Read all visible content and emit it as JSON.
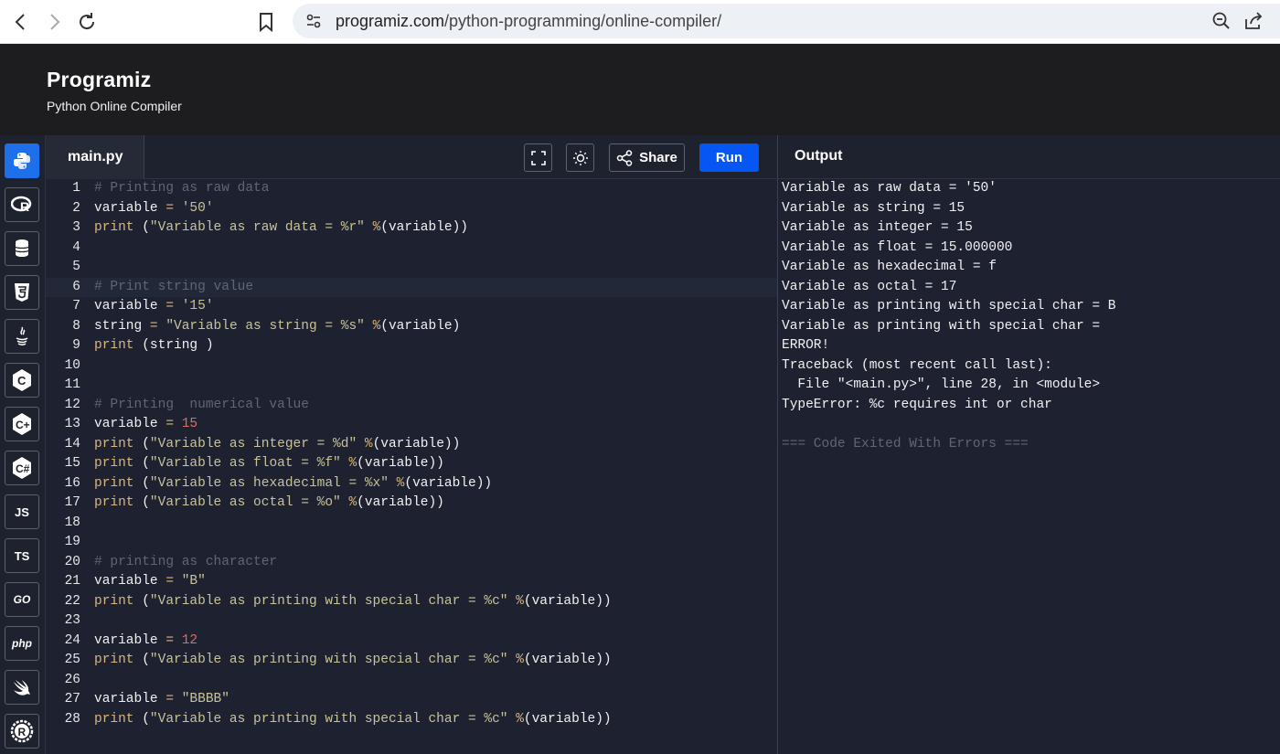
{
  "browser": {
    "url_domain": "programiz.com",
    "url_path": "/python-programming/online-compiler/"
  },
  "header": {
    "logo": "Programiz",
    "subtitle": "Python Online Compiler"
  },
  "languages": [
    {
      "name": "python",
      "label": "",
      "active": true
    },
    {
      "name": "r",
      "label": "R"
    },
    {
      "name": "sql",
      "label": ""
    },
    {
      "name": "html",
      "label": "5"
    },
    {
      "name": "java",
      "label": ""
    },
    {
      "name": "c",
      "label": "C"
    },
    {
      "name": "cpp",
      "label": "C+"
    },
    {
      "name": "csharp",
      "label": "C#"
    },
    {
      "name": "javascript",
      "label": "JS"
    },
    {
      "name": "typescript",
      "label": "TS"
    },
    {
      "name": "go",
      "label": "GO"
    },
    {
      "name": "php",
      "label": "php"
    },
    {
      "name": "swift",
      "label": ""
    },
    {
      "name": "rust",
      "label": "R"
    }
  ],
  "editor": {
    "filename": "main.py",
    "share_label": "Share",
    "run_label": "Run",
    "active_line": 6,
    "lines": [
      "# Printing as raw data",
      "variable = '50'",
      "print (\"Variable as raw data = %r\" %(variable))",
      "",
      "",
      "# Print string value",
      "variable = '15'",
      "string = \"Variable as string = %s\" %(variable)",
      "print (string )",
      "",
      "",
      "# Printing  numerical value",
      "variable = 15",
      "print (\"Variable as integer = %d\" %(variable))",
      "print (\"Variable as float = %f\" %(variable))",
      "print (\"Variable as hexadecimal = %x\" %(variable))",
      "print (\"Variable as octal = %o\" %(variable))",
      "",
      "",
      "# printing as character",
      "variable = \"B\"",
      "print (\"Variable as printing with special char = %c\" %(variable))",
      "",
      "variable = 12",
      "print (\"Variable as printing with special char = %c\" %(variable))",
      "",
      "variable = \"BBBB\"",
      "print (\"Variable as printing with special char = %c\" %(variable))"
    ]
  },
  "output": {
    "title": "Output",
    "lines": [
      "Variable as raw data = '50'",
      "Variable as string = 15",
      "Variable as integer = 15",
      "Variable as float = 15.000000",
      "Variable as hexadecimal = f",
      "Variable as octal = 17",
      "Variable as printing with special char = B",
      "Variable as printing with special char = ",
      "ERROR!",
      "Traceback (most recent call last):",
      "  File \"<main.py>\", line 28, in <module>",
      "TypeError: %c requires int or char",
      "",
      "=== Code Exited With Errors ==="
    ]
  }
}
